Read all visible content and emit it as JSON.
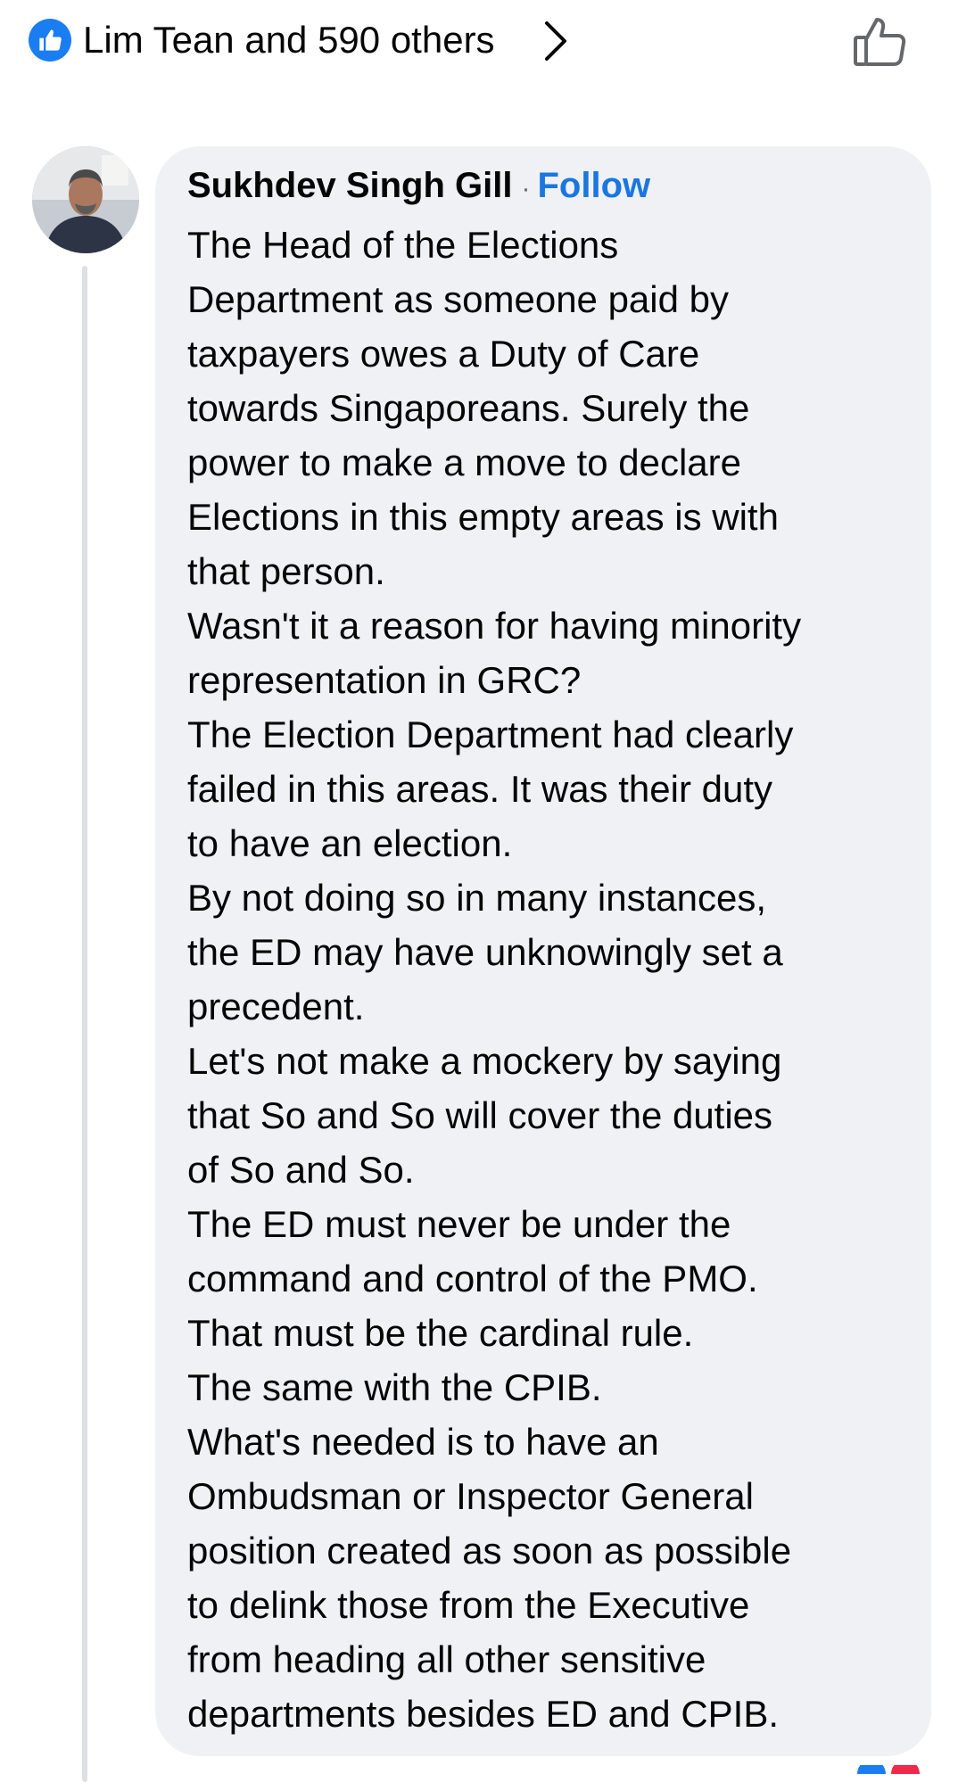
{
  "reactions": {
    "summary": "Lim Tean and 590 others"
  },
  "colors": {
    "accent": "#1a77e0",
    "bubble": "#f0f1f5",
    "like_badge": "#1a7df2",
    "thread_line": "#dde0e5"
  },
  "icons": {
    "like_badge": "like-thumb-icon",
    "chevron": "chevron-right-icon",
    "like_button": "thumbs-up-outline-icon"
  },
  "comment": {
    "author": "Sukhdev Singh Gill",
    "separator": "·",
    "follow_label": "Follow",
    "lines": [
      "The Head of the Elections",
      "Department as someone paid by",
      "taxpayers owes a Duty of Care",
      "towards Singaporeans. Surely the",
      "power to make a move to declare",
      "Elections in this empty areas is with",
      "that person.",
      "Wasn't it a reason for having minority",
      "representation in GRC?",
      "The Election Department had clearly",
      "failed in this areas. It was their duty",
      "to have an election.",
      "By not doing so in many instances,",
      "the ED may have unknowingly set a",
      "precedent.",
      "Let's not make a mockery by saying",
      "that So and So will cover the duties",
      "of So and So.",
      "The ED must never be under the",
      "command and control of the PMO.",
      "That must be the cardinal rule.",
      "The same with the CPIB.",
      "What's needed is to have an",
      "Ombudsman or Inspector General",
      "position created as soon as possible",
      "to delink those from the Executive",
      "from heading all other sensitive",
      "departments besides ED and CPIB."
    ]
  }
}
